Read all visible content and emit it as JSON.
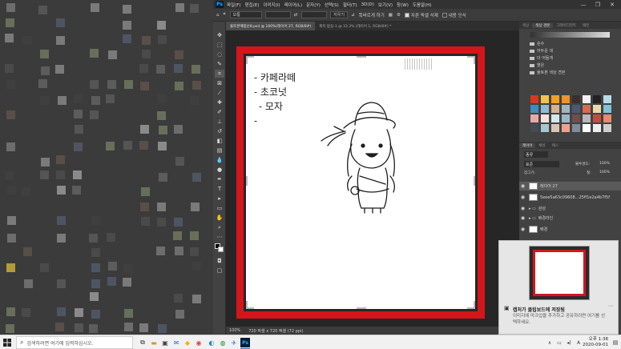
{
  "menubar": {
    "app_label": "Ps",
    "items": [
      "파일(F)",
      "편집(E)",
      "이미지(I)",
      "레이어(L)",
      "문자(Y)",
      "선택(S)",
      "필터(T)",
      "3D(D)",
      "보기(V)",
      "창(W)",
      "도움말(H)"
    ]
  },
  "options_bar": {
    "style_value": "보통",
    "clear_label": "지우기",
    "straighten_label": "똑바르게 하기",
    "delete_cropped_label": "자른 픽셀 삭제",
    "content_aware_label": "내용 인식"
  },
  "doc_tabs": [
    {
      "label": "율토본메럽순8.psd @ 100%(레이어 27, RGB/8#)"
    },
    {
      "label": "제목 없음-1 @ 33.3% (레이어 1, RGB/8#) *"
    }
  ],
  "statusbar": {
    "zoom": "100%",
    "doc_info": "720 픽셀 x 720 픽셀 (72 ppi)"
  },
  "canvas_text": [
    "카페라떼",
    "초코넛",
    "모자"
  ],
  "swatches_panel": {
    "tabs": [
      "색상",
      "색상 견본",
      "그레이디언트",
      "패턴"
    ],
    "folders": [
      "순수",
      "어두운 색",
      "더 어둡게",
      "옅은",
      "율토본 색상 견본"
    ],
    "colors": [
      "#d9381e",
      "#f3c44a",
      "#f4a020",
      "#f2912c",
      "#3a2f2b",
      "#f2f2f2",
      "#222222",
      "#b9dbe8",
      "#3e8bbd",
      "#8fbbd6",
      "#d7b08f",
      "#a1b5bf",
      "#4a5a74",
      "#d46b55",
      "#ecd9a8",
      "#7fc3d6",
      "#e8a8a8",
      "#f6e1e1",
      "#d1e8ec",
      "#9ab8c9",
      "#6d4f4e",
      "#b8b8b8",
      "#c14d3f",
      "#e78b6e",
      "#454a56",
      "#a6c6d2",
      "#d9c6b3",
      "#f0a28f",
      "#7e8d9b",
      "#ffffff",
      "#eeeeee",
      "#cfcfcf"
    ]
  },
  "layers_panel": {
    "tabs": [
      "레이어",
      "채널",
      "패스"
    ],
    "kind_label": "종류",
    "blend_mode": "표준",
    "opacity_label": "불투명도:",
    "opacity_value": "100%",
    "lock_label": "잠그기:",
    "fill_label": "칠:",
    "fill_value": "100%",
    "layers": [
      {
        "name": "레이어 27",
        "selected": true
      },
      {
        "name": "5eee5a63c09608...25ff1e2a4b7f5f",
        "selected": false
      },
      {
        "name": "완성",
        "selected": false
      },
      {
        "name": "배경라인",
        "selected": false
      },
      {
        "name": "배경",
        "selected": false
      }
    ]
  },
  "toast": {
    "title": "캡처가 클립보드에 저장됨",
    "body": "이미지에 마크업을 추가하고 공유하려면 여기를 선택하세요."
  },
  "taskbar": {
    "search_placeholder": "검색하려면 여기에 입력하십시오.",
    "time": "오후 1:38",
    "date": "2020-09-01",
    "ime": "A"
  },
  "colors": {
    "red_frame": "#d4161b",
    "ps_accent": "#31a8ff"
  }
}
